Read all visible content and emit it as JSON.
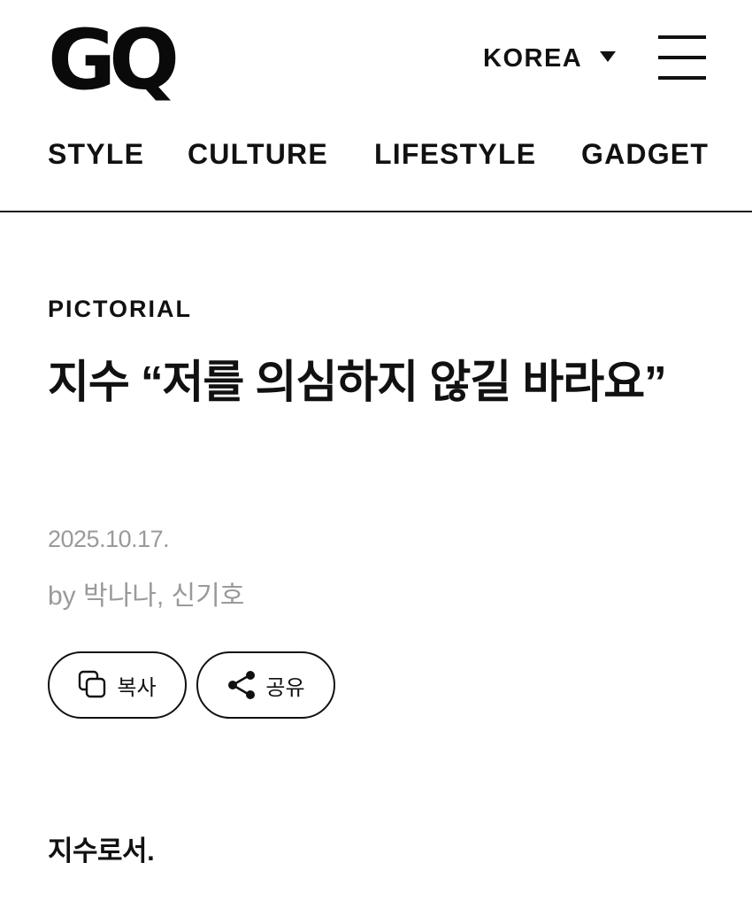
{
  "header": {
    "logo": "GQ",
    "region": "KOREA",
    "nav": [
      "STYLE",
      "CULTURE",
      "LIFESTYLE",
      "GADGET"
    ]
  },
  "article": {
    "category": "PICTORIAL",
    "title": "지수 “저를 의심하지 않길 바라요”",
    "date": "2025.10.17.",
    "byline": "by 박나나, 신기호",
    "actions": {
      "copy": "복사",
      "share": "공유"
    },
    "body_first": "지수로서."
  },
  "icons": {
    "region_caret": "caret-down-icon",
    "menu": "hamburger-menu-icon",
    "copy": "copy-icon",
    "share": "share-icon"
  }
}
